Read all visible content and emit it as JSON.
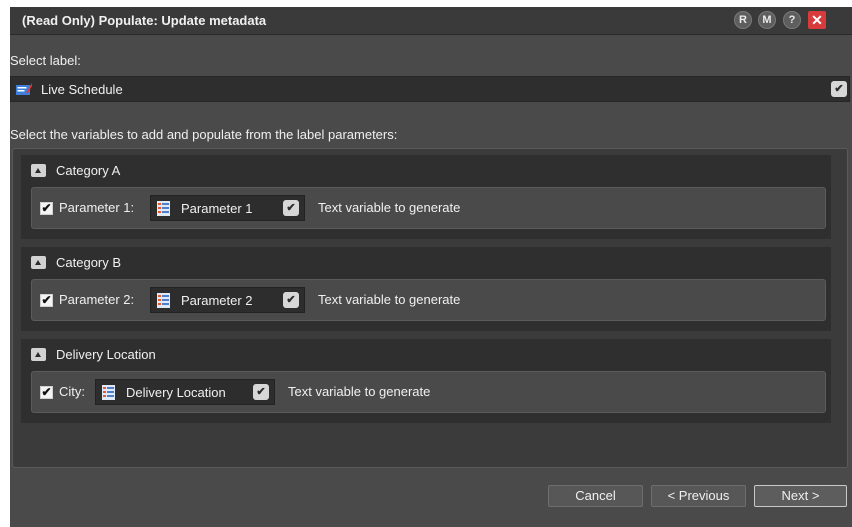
{
  "dialog": {
    "title": "(Read Only) Populate: Update metadata",
    "controls": {
      "r": "R",
      "m": "M",
      "help": "?",
      "close": "✕"
    }
  },
  "label_select": {
    "caption": "Select label:",
    "selected": "Live Schedule",
    "icon": "label-icon"
  },
  "variables": {
    "caption": "Select the variables to add and populate from the label parameters:",
    "groups": [
      {
        "title": "Category A",
        "param_label": "Parameter 1:",
        "checked": true,
        "combo_value": "Parameter 1",
        "hint": "Text variable to generate"
      },
      {
        "title": "Category B",
        "param_label": "Parameter 2:",
        "checked": true,
        "combo_value": "Parameter 2",
        "hint": "Text variable to generate"
      },
      {
        "title": "Delivery Location",
        "param_label": "City:",
        "checked": true,
        "combo_value": "Delivery Location",
        "hint": "Text variable to generate"
      }
    ]
  },
  "footer": {
    "cancel": "Cancel",
    "previous": "< Previous",
    "next": "Next >"
  },
  "colors": {
    "background": "#4a4a4a",
    "titlebar": "#3a3a3a",
    "close": "#d83b3b"
  }
}
